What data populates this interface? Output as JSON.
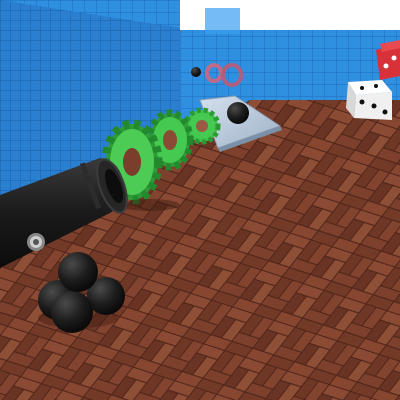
{
  "scene": {
    "type": "3d-physics-playground",
    "objects": [
      {
        "kind": "cannon",
        "color": "#1c1c1c"
      },
      {
        "kind": "cannonball",
        "count": 5,
        "color": "#1a1a1a"
      },
      {
        "kind": "gear",
        "count": 3,
        "color": "#3fc34a"
      },
      {
        "kind": "ramp",
        "color": "#b8c8dc"
      },
      {
        "kind": "ring",
        "count": 2,
        "color": "#c06a8a"
      },
      {
        "kind": "dice",
        "count": 2,
        "colors": [
          "#f2f2f2",
          "#d8313a"
        ]
      },
      {
        "kind": "ball",
        "count": 2,
        "color": "#1a1a1a"
      }
    ],
    "floor": {
      "pattern": "herringbone-wood",
      "color": "#7a3e2c"
    },
    "walls": {
      "pattern": "tiles",
      "color": "#2f8fe0"
    }
  }
}
